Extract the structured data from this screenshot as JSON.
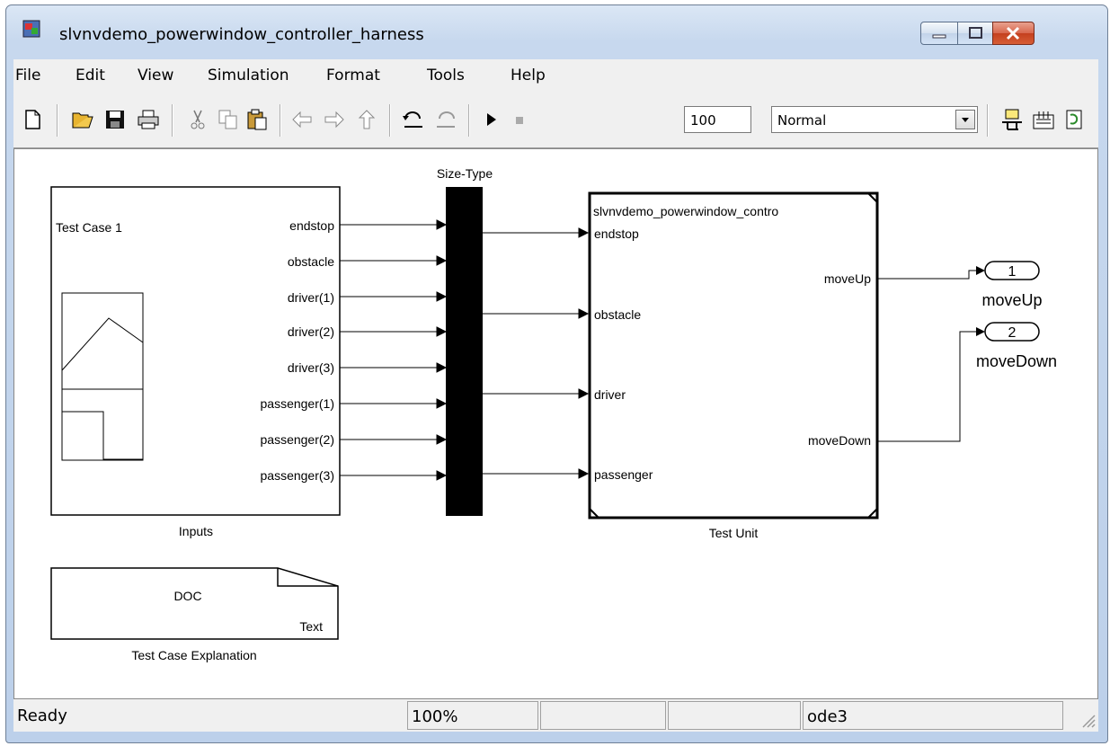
{
  "window": {
    "title": "slvnvdemo_powerwindow_controller_harness"
  },
  "menu": [
    "File",
    "Edit",
    "View",
    "Simulation",
    "Format",
    "Tools",
    "Help"
  ],
  "toolbar": {
    "stop_time": "100",
    "sim_mode": "Normal",
    "icons": [
      "new-icon",
      "open-icon",
      "save-icon",
      "print-icon",
      "cut-icon",
      "copy-icon",
      "paste-icon",
      "back-icon",
      "forward-icon",
      "up-icon",
      "undo-icon",
      "redo-icon",
      "play-icon",
      "stop-icon",
      "build-icon",
      "library-icon",
      "refresh-icon"
    ]
  },
  "diagram": {
    "inputs_block": {
      "label": "Inputs",
      "inner_title": "Test Case 1",
      "ports": [
        "endstop",
        "obstacle",
        "driver(1)",
        "driver(2)",
        "driver(3)",
        "passenger(1)",
        "passenger(2)",
        "passenger(3)"
      ]
    },
    "mux_block": {
      "label": "Size-Type"
    },
    "test_unit": {
      "label": "Test Unit",
      "inner_title": "slvnvdemo_powerwindow_contro",
      "in_ports": [
        "endstop",
        "obstacle",
        "driver",
        "passenger"
      ],
      "out_ports": [
        "moveUp",
        "moveDown"
      ]
    },
    "outports": [
      {
        "number": "1",
        "name": "moveUp"
      },
      {
        "number": "2",
        "name": "moveDown"
      }
    ],
    "doc_block": {
      "label": "Test Case Explanation",
      "title": "DOC",
      "subtitle": "Text"
    }
  },
  "status": {
    "state": "Ready",
    "zoom": "100%",
    "solver": "ode3"
  }
}
